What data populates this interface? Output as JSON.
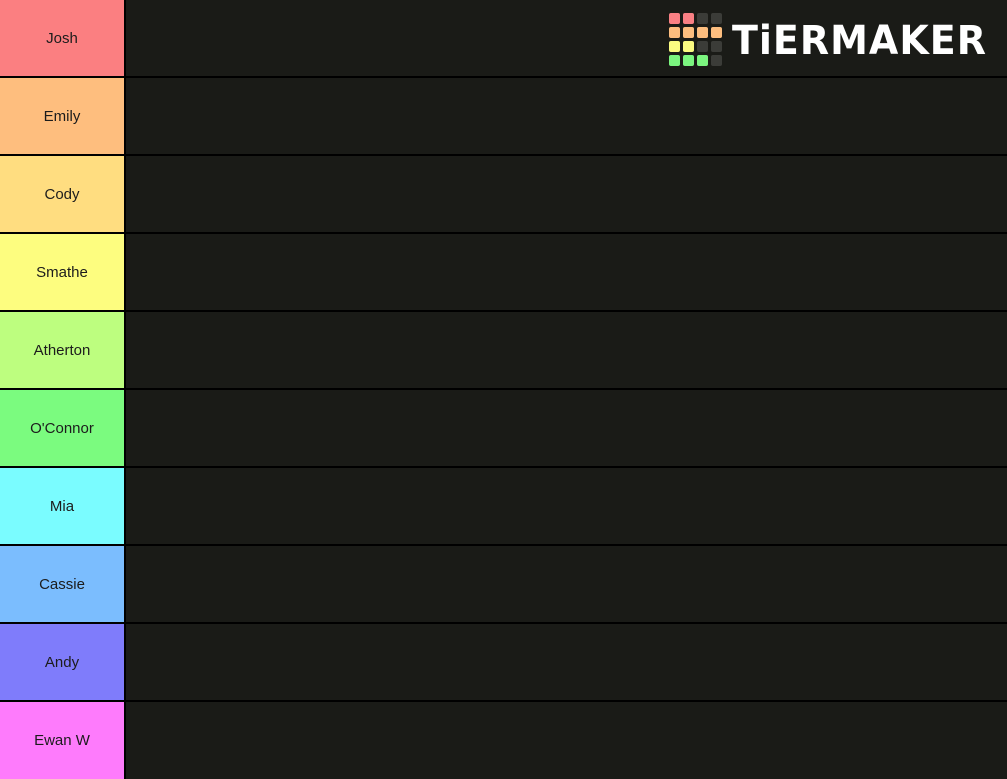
{
  "app": {
    "name": "TierMaker",
    "brand_text": "TiERMAKER",
    "background_color": "#1a1b17",
    "border_color": "#000000",
    "label_text_color": "#1c1c1c"
  },
  "logo": {
    "icon_name": "tiermaker-grid-logo",
    "grid_colors": [
      [
        "#f98084",
        "#f98084",
        "#3b3c38",
        "#3b3c38"
      ],
      [
        "#fdbe7f",
        "#fdbe7f",
        "#fdbe7f",
        "#fdbe7f"
      ],
      [
        "#fbfb81",
        "#fbfb81",
        "#3b3c38",
        "#3b3c38"
      ],
      [
        "#7bf57f",
        "#7bf57f",
        "#7bf57f",
        "#3b3c38"
      ]
    ],
    "empty_cell_color": "#3b3c38"
  },
  "tiers": [
    {
      "label": "Josh",
      "color": "#fb7f81",
      "row_index": 0,
      "items": []
    },
    {
      "label": "Emily",
      "color": "#febe7e",
      "row_index": 1,
      "items": []
    },
    {
      "label": "Cody",
      "color": "#ffdd80",
      "row_index": 2,
      "items": []
    },
    {
      "label": "Smathe",
      "color": "#fdfd7f",
      "row_index": 3,
      "items": []
    },
    {
      "label": "Atherton",
      "color": "#bdfe7f",
      "row_index": 4,
      "items": []
    },
    {
      "label": "O'Connor",
      "color": "#7bfb7f",
      "row_index": 5,
      "items": []
    },
    {
      "label": "Mia",
      "color": "#7afcff",
      "row_index": 6,
      "items": []
    },
    {
      "label": "Cassie",
      "color": "#7bbdfe",
      "row_index": 7,
      "items": []
    },
    {
      "label": "Andy",
      "color": "#7f7cfb",
      "row_index": 8,
      "items": []
    },
    {
      "label": "Ewan W",
      "color": "#fe7bfc",
      "row_index": 9,
      "items": []
    }
  ]
}
